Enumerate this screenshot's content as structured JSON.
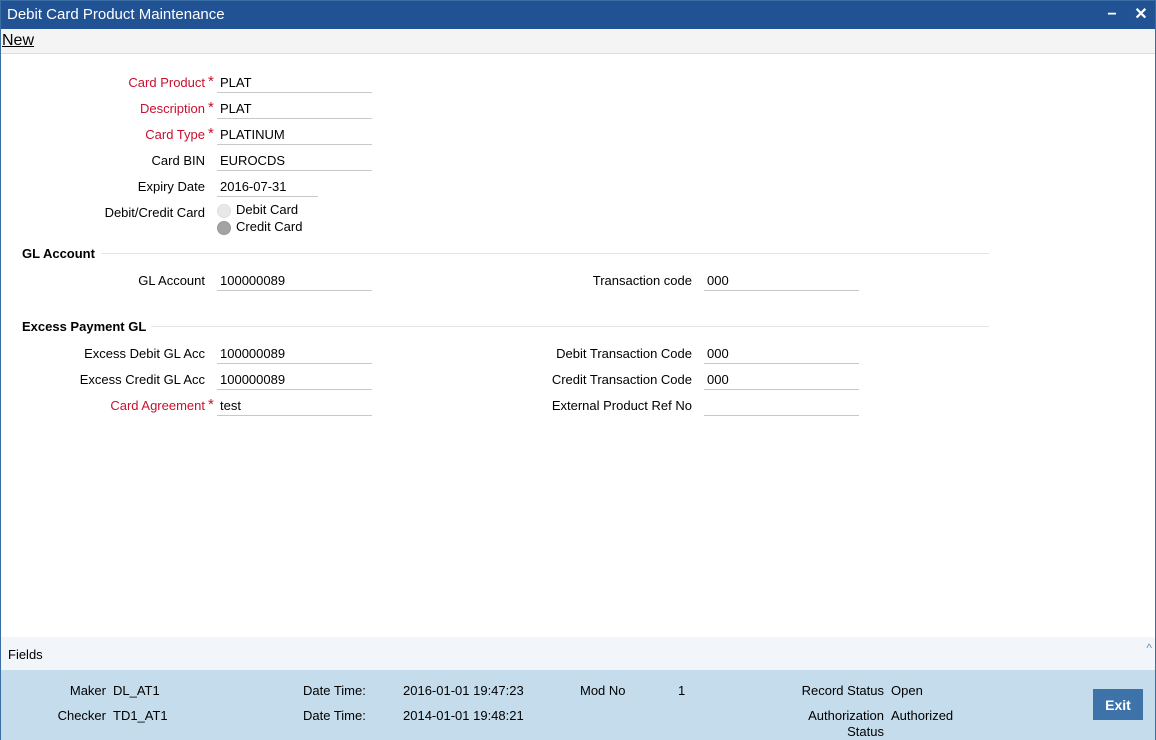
{
  "window": {
    "title": "Debit Card Product Maintenance",
    "minimize_label": "−",
    "close_label": "✕"
  },
  "toolbar": {
    "new_label": "New"
  },
  "form": {
    "card_product": {
      "label": "Card Product",
      "required_mark": "*",
      "value": "PLAT"
    },
    "description": {
      "label": "Description",
      "required_mark": "*",
      "value": "PLAT"
    },
    "card_type": {
      "label": "Card Type",
      "required_mark": "*",
      "value": "PLATINUM"
    },
    "card_bin": {
      "label": "Card BIN",
      "value": "EUROCDS"
    },
    "expiry_date": {
      "label": "Expiry Date",
      "value": "2016-07-31"
    },
    "debit_credit": {
      "label": "Debit/Credit Card",
      "options": [
        {
          "label": "Debit Card",
          "selected": false
        },
        {
          "label": "Credit Card",
          "selected": true
        }
      ]
    }
  },
  "gl_account": {
    "heading": "GL Account",
    "gl_account": {
      "label": "GL Account",
      "value": "100000089"
    },
    "transaction_code": {
      "label": "Transaction code",
      "value": "000"
    }
  },
  "excess_payment": {
    "heading": "Excess Payment GL",
    "excess_debit": {
      "label": "Excess Debit GL Acc",
      "value": "100000089"
    },
    "excess_credit": {
      "label": "Excess Credit GL Acc",
      "value": "100000089"
    },
    "card_agreement": {
      "label": "Card Agreement",
      "required_mark": "*",
      "value": "test"
    },
    "debit_txn_code": {
      "label": "Debit Transaction Code",
      "value": "000"
    },
    "credit_txn_code": {
      "label": "Credit Transaction Code",
      "value": "000"
    },
    "ext_product_ref": {
      "label": "External Product Ref No",
      "value": ""
    }
  },
  "fields_bar": {
    "label": "Fields",
    "caret": "^"
  },
  "audit": {
    "maker_label": "Maker",
    "maker_value": "DL_AT1",
    "checker_label": "Checker",
    "checker_value": "TD1_AT1",
    "date_time_label": "Date Time:",
    "maker_datetime": "2016-01-01 19:47:23",
    "checker_datetime": "2014-01-01 19:48:21",
    "mod_no_label": "Mod No",
    "mod_no_value": "1",
    "record_status_label": "Record Status",
    "record_status_value": "Open",
    "auth_status_label_1": "Authorization",
    "auth_status_label_2": "Status",
    "auth_status_value": "Authorized",
    "exit_label": "Exit"
  }
}
